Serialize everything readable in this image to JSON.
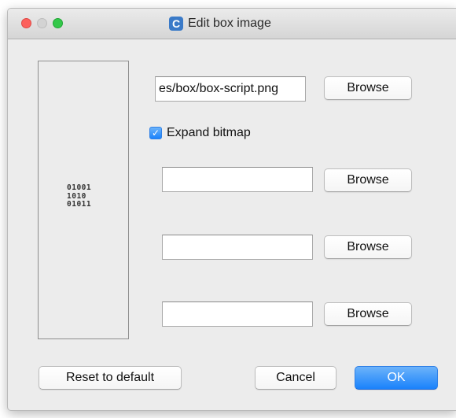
{
  "window": {
    "title": "Edit box image",
    "app_icon_letter": "C"
  },
  "preview": {
    "icon": "binary-file-icon",
    "icon_lines": [
      "01001",
      "1010",
      "01011"
    ]
  },
  "rows": [
    {
      "value": "es/box/box-script.png",
      "placeholder": "",
      "browse_label": "Browse"
    },
    {
      "value": "",
      "placeholder": "",
      "browse_label": "Browse"
    },
    {
      "value": "",
      "placeholder": "",
      "browse_label": "Browse"
    },
    {
      "value": "",
      "placeholder": "",
      "browse_label": "Browse"
    }
  ],
  "expand_bitmap": {
    "label": "Expand bitmap",
    "checked": true
  },
  "footer": {
    "reset_label": "Reset to default",
    "cancel_label": "Cancel",
    "ok_label": "OK"
  },
  "colors": {
    "accent": "#1a82fb",
    "close": "#fc605c",
    "zoom": "#34c84a"
  }
}
